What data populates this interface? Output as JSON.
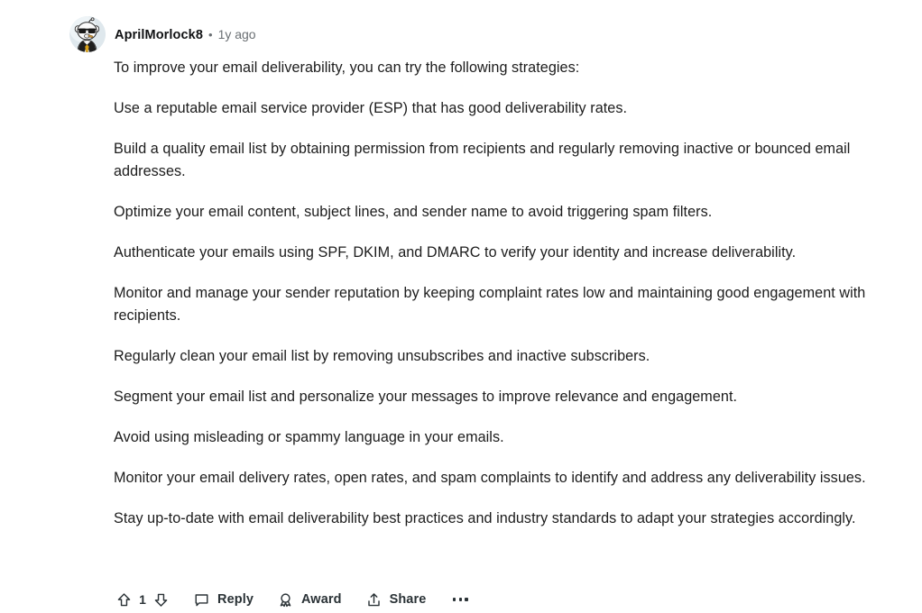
{
  "comment": {
    "author": {
      "username": "AprilMorlock8",
      "avatar_icon": "snoo-sunglasses-suit-avatar"
    },
    "separator": "•",
    "timestamp": "1y ago",
    "paragraphs": [
      "To improve your email deliverability, you can try the following strategies:",
      "Use a reputable email service provider (ESP) that has good deliverability rates.",
      "Build a quality email list by obtaining permission from recipients and regularly removing inactive or bounced email addresses.",
      "Optimize your email content, subject lines, and sender name to avoid triggering spam filters.",
      "Authenticate your emails using SPF, DKIM, and DMARC to verify your identity and increase deliverability.",
      "Monitor and manage your sender reputation by keeping complaint rates low and maintaining good engagement with recipients.",
      "Regularly clean your email list by removing unsubscribes and inactive subscribers.",
      "Segment your email list and personalize your messages to improve relevance and engagement.",
      "Avoid using misleading or spammy language in your emails.",
      "Monitor your email delivery rates, open rates, and spam complaints to identify and address any deliverability issues.",
      "Stay up-to-date with email deliverability best practices and industry standards to adapt your strategies accordingly."
    ]
  },
  "actions": {
    "upvote_icon": "arrow-up-icon",
    "vote_count": "1",
    "downvote_icon": "arrow-down-icon",
    "reply_icon": "speech-bubble-icon",
    "reply_label": "Reply",
    "award_icon": "award-medal-icon",
    "award_label": "Award",
    "share_icon": "share-upload-icon",
    "share_label": "Share",
    "overflow_icon": "more-horizontal-icon"
  },
  "colors": {
    "background": "#ffffff",
    "body_text": "#1c1c1c",
    "meta_text": "#6a6f73",
    "action_text": "#2a3236"
  }
}
